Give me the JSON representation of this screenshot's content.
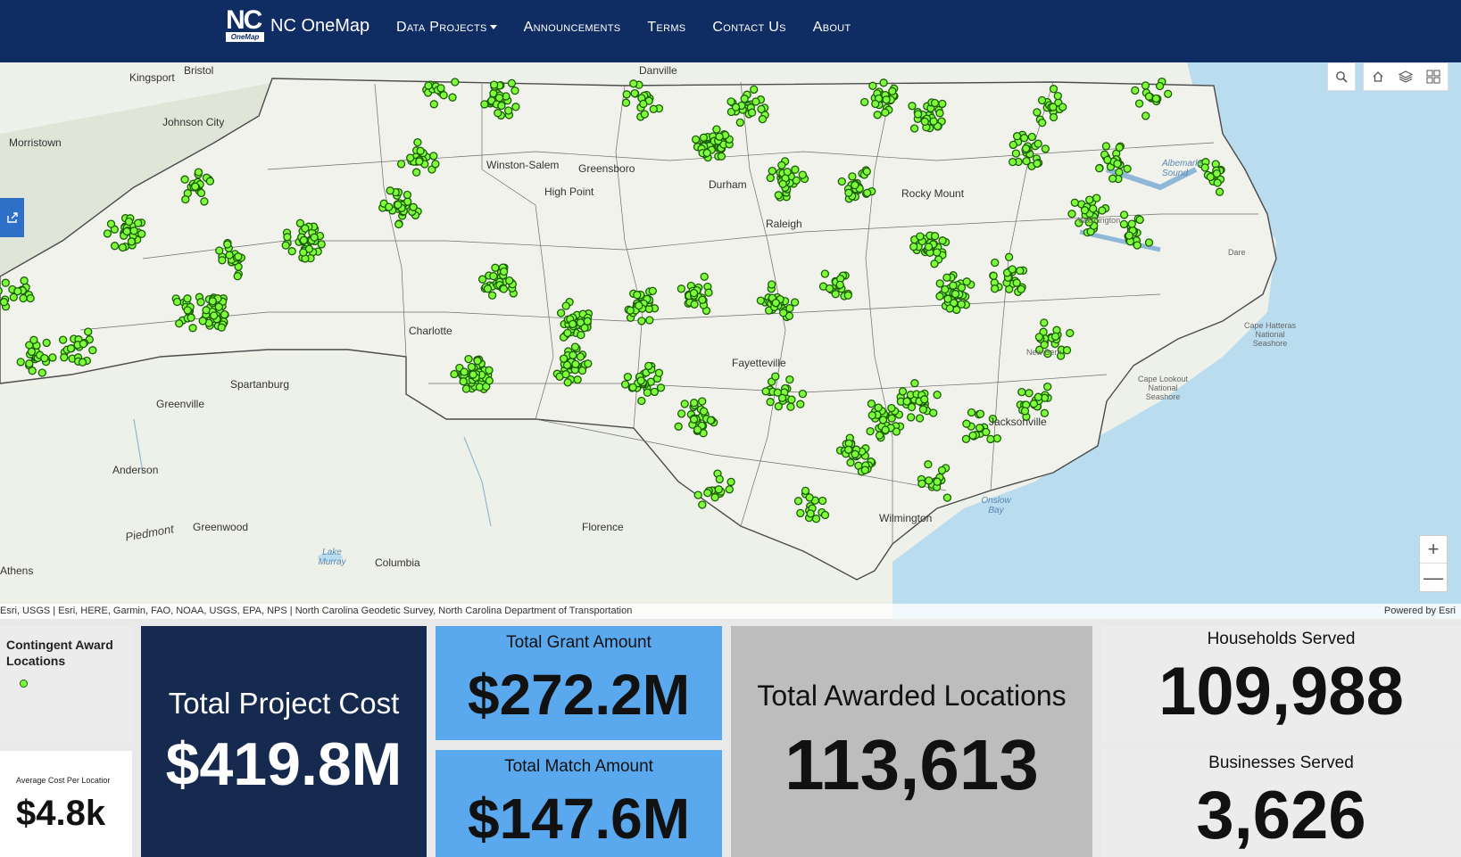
{
  "nav": {
    "logo_main": "NC",
    "logo_sub": "OneMap",
    "brand": "NC OneMap",
    "links": [
      "Data Projects",
      "Announcements",
      "Terms",
      "Contact Us",
      "About"
    ]
  },
  "map": {
    "labels": {
      "kingsport": "Kingsport",
      "bristol": "Bristol",
      "danville": "Danville",
      "johnson_city": "Johnson City",
      "morristown": "Morristown",
      "winston_salem": "Winston-Salem",
      "greensboro": "Greensboro",
      "high_point": "High Point",
      "durham": "Durham",
      "raleigh": "Raleigh",
      "rocky_mount": "Rocky Mount",
      "greenville_sc": "Greenville",
      "spartanburg": "Spartanburg",
      "charlotte": "Charlotte",
      "fayetteville": "Fayetteville",
      "jacksonville": "Jacksonville",
      "wilmington": "Wilmington",
      "florence": "Florence",
      "columbia": "Columbia",
      "anderson": "Anderson",
      "greenwood": "Greenwood",
      "athens": "Athens",
      "piedmont": "Piedmont",
      "onslow_bay": "Onslow Bay",
      "albemarle_sound": "Albemarle Sound",
      "cape_hatteras": "Cape Hatteras National Seashore",
      "cape_lookout": "Cape Lookout National Seashore",
      "dare": "Dare",
      "new_bern": "New Bern",
      "washington": "Washington",
      "lake_murray": "Lake Murray"
    },
    "tools": [
      "search-icon",
      "home-icon",
      "layers-icon",
      "basemap-icon"
    ],
    "zoom_in": "+",
    "zoom_out": "—",
    "attribution_left": "Esri, USGS | Esri, HERE, Garmin, FAO, NOAA, USGS, EPA, NPS | North Carolina Geodetic Survey, North Carolina Department of Transportation",
    "attribution_right": "Powered by Esri",
    "marker_color": "#7dff3a",
    "marker_stroke": "#1c5c06"
  },
  "legend": {
    "title": "Contingent Award Locations"
  },
  "average": {
    "title": "Average Cost Per Locatior",
    "value": "$4.8k"
  },
  "cost": {
    "title": "Total Project Cost",
    "value": "$419.8M"
  },
  "grant": {
    "title": "Total Grant Amount",
    "value": "$272.2M"
  },
  "match": {
    "title": "Total Match Amount",
    "value": "$147.6M"
  },
  "locations": {
    "title": "Total Awarded Locations",
    "value": "113,613"
  },
  "households": {
    "title": "Households Served",
    "value": "109,988"
  },
  "businesses": {
    "title": "Businesses Served",
    "value": "3,626"
  },
  "colors": {
    "nav": "#0f2c63",
    "cost_card": "#162a4f",
    "blue_card": "#5aa9ee",
    "grey_card": "#bdbdbd",
    "light_card": "#ececec",
    "water": "#b9dcef"
  }
}
